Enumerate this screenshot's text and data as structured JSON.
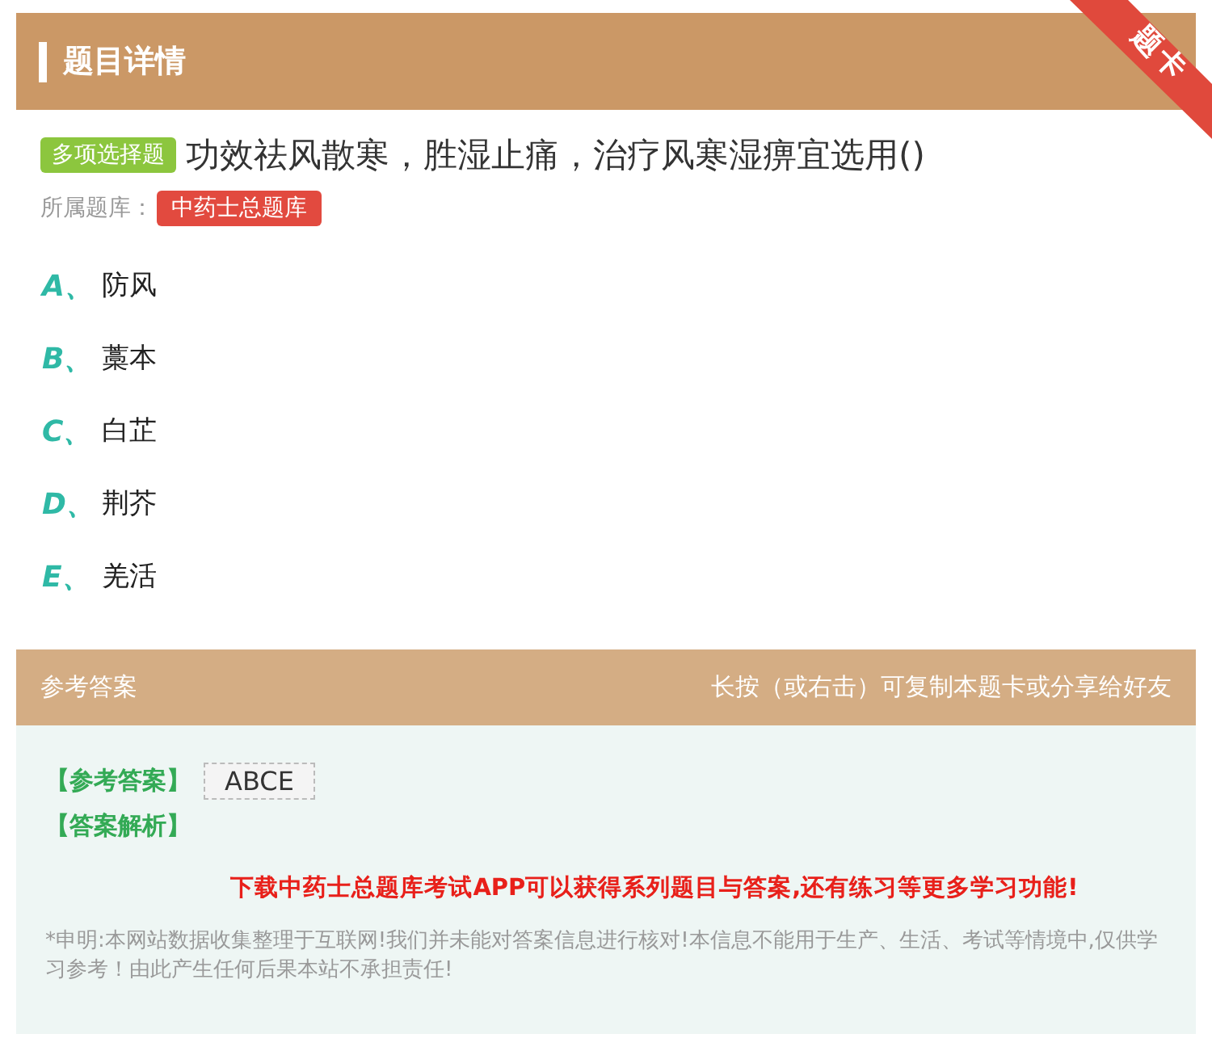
{
  "header": {
    "title": "题目详情",
    "ribbon": "题卡"
  },
  "question": {
    "type_badge": "多项选择题",
    "text": "功效祛风散寒，胜湿止痛，治疗风寒湿痹宜选用()",
    "bank_label": "所属题库：",
    "bank": "中药士总题库"
  },
  "options": [
    {
      "letter": "A、",
      "text": "防风"
    },
    {
      "letter": "B、",
      "text": "藁本"
    },
    {
      "letter": "C、",
      "text": "白芷"
    },
    {
      "letter": "D、",
      "text": "荆芥"
    },
    {
      "letter": "E、",
      "text": "羌活"
    }
  ],
  "answer_bar": {
    "title": "参考答案",
    "hint": "长按（或右击）可复制本题卡或分享给好友"
  },
  "answer": {
    "answer_label": "【参考答案】",
    "answer_value": "ABCE",
    "analysis_label": "【答案解析】",
    "promo": "下载中药士总题库考试APP可以获得系列题目与答案,还有练习等更多学习功能!",
    "disclaimer": "*申明:本网站数据收集整理于互联网!我们并未能对答案信息进行核对!本信息不能用于生产、生活、考试等情境中,仅供学习参考！由此产生任何后果本站不承担责任!"
  }
}
